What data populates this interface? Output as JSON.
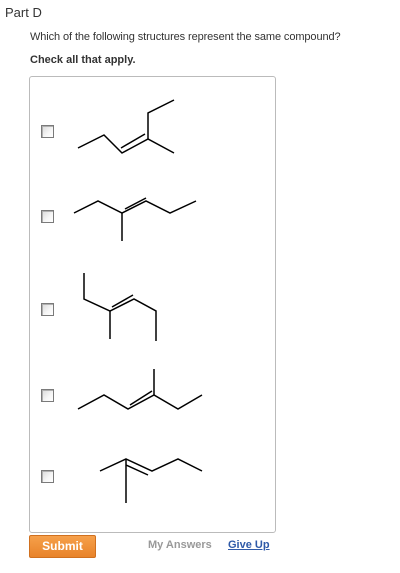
{
  "part": {
    "title": "Part D"
  },
  "question": {
    "text": "Which of the following structures represent the same compound?",
    "instruction": "Check all that apply."
  },
  "choices": [
    {
      "checked": false,
      "structure": "skeletal-structure-1"
    },
    {
      "checked": false,
      "structure": "skeletal-structure-2"
    },
    {
      "checked": false,
      "structure": "skeletal-structure-3"
    },
    {
      "checked": false,
      "structure": "skeletal-structure-4"
    },
    {
      "checked": false,
      "structure": "skeletal-structure-5"
    }
  ],
  "actions": {
    "submit_label": "Submit",
    "my_answers_label": "My Answers",
    "give_up_label": "Give Up"
  },
  "colors": {
    "submit_button": "#ef8c35",
    "link": "#2f5aa8",
    "muted_text": "#999999"
  }
}
